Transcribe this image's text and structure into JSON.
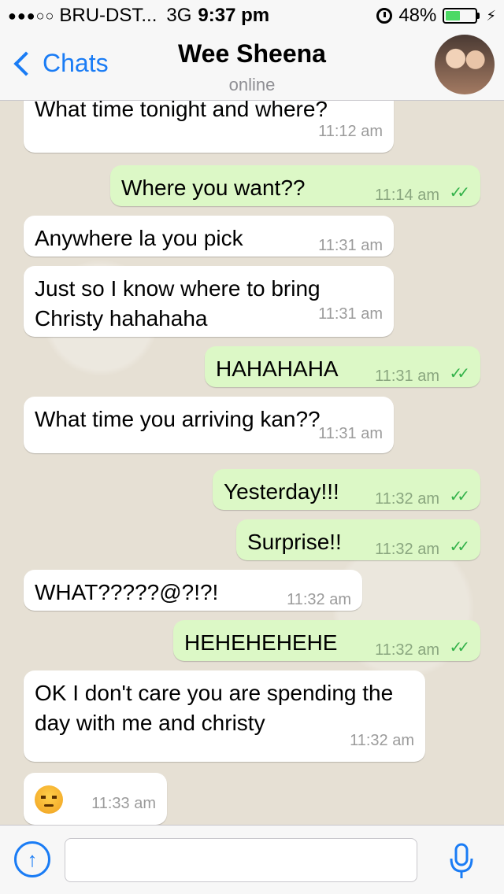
{
  "status_bar": {
    "signal": "●●●○○",
    "carrier": "BRU-DST...",
    "network": "3G",
    "time": "9:37 pm",
    "battery": "48%",
    "battery_level": 0.48
  },
  "nav": {
    "back_label": "Chats",
    "contact_name": "Wee Sheena",
    "contact_status": "online"
  },
  "messages": [
    {
      "dir": "in",
      "text": "What time tonight and where?",
      "time": "11:12 am"
    },
    {
      "dir": "out",
      "text": "Where you want??",
      "time": "11:14 am",
      "ticks": "✓✓"
    },
    {
      "dir": "in",
      "text": "Anywhere la you pick",
      "time": "11:31 am"
    },
    {
      "dir": "in",
      "text": "Just so I know where to bring Christy hahahaha",
      "time": "11:31 am"
    },
    {
      "dir": "out",
      "text": "HAHAHAHA",
      "time": "11:31 am",
      "ticks": "✓✓"
    },
    {
      "dir": "in",
      "text": "What time you arriving kan??",
      "time": "11:31 am"
    },
    {
      "dir": "out",
      "text": "Yesterday!!!",
      "time": "11:32 am",
      "ticks": "✓✓"
    },
    {
      "dir": "out",
      "text": "Surprise!!",
      "time": "11:32 am",
      "ticks": "✓✓"
    },
    {
      "dir": "in",
      "text": "WHAT?????@?!?!",
      "time": "11:32 am"
    },
    {
      "dir": "out",
      "text": "HEHEHEHEHE",
      "time": "11:32 am",
      "ticks": "✓✓"
    },
    {
      "dir": "in",
      "text": "OK I don't care you are spending the day with me and christy",
      "time": "11:32 am"
    },
    {
      "dir": "in",
      "text": "",
      "emoji": "angry-face",
      "time": "11:33 am"
    }
  ],
  "input": {
    "placeholder": ""
  },
  "icons": {
    "upload": "upload-icon",
    "mic": "microphone-icon"
  },
  "colors": {
    "accent": "#1a7cf5",
    "outgoing_bubble": "#dcf8c6",
    "incoming_bubble": "#ffffff",
    "ticks": "#34b24a",
    "battery": "#4cd964"
  }
}
